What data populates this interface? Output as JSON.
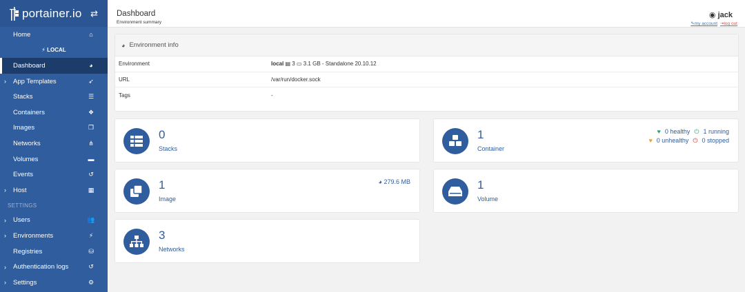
{
  "app": {
    "logo_text": "portainer.io"
  },
  "sidebar": {
    "items": [
      {
        "label": "Home",
        "icon": "home-icon"
      },
      {
        "label": "LOCAL",
        "icon": "plug-icon"
      },
      {
        "label": "Dashboard",
        "icon": "dashboard-icon"
      },
      {
        "label": "App Templates",
        "icon": "rocket-icon"
      },
      {
        "label": "Stacks",
        "icon": "list-icon"
      },
      {
        "label": "Containers",
        "icon": "cubes-icon"
      },
      {
        "label": "Images",
        "icon": "clone-icon"
      },
      {
        "label": "Networks",
        "icon": "sitemap-icon"
      },
      {
        "label": "Volumes",
        "icon": "hdd-icon"
      },
      {
        "label": "Events",
        "icon": "history-icon"
      },
      {
        "label": "Host",
        "icon": "th-icon"
      },
      {
        "label": "SETTINGS"
      },
      {
        "label": "Users",
        "icon": "users-icon"
      },
      {
        "label": "Environments",
        "icon": "plug-icon"
      },
      {
        "label": "Registries",
        "icon": "database-icon"
      },
      {
        "label": "Authentication logs",
        "icon": "history-icon"
      },
      {
        "label": "Settings",
        "icon": "cogs-icon"
      }
    ]
  },
  "header": {
    "title": "Dashboard",
    "subtitle": "Environment summary",
    "user": "jack",
    "my_account": "my account",
    "log_out": "log out"
  },
  "env_info": {
    "title": "Environment info",
    "rows": {
      "environment": {
        "key": "Environment",
        "name": "local",
        "cpu": "3",
        "mem": "3.1 GB",
        "type": "- Standalone 20.10.12"
      },
      "url": {
        "key": "URL",
        "value": "/var/run/docker.sock"
      },
      "tags": {
        "key": "Tags",
        "value": "-"
      }
    }
  },
  "widgets": {
    "stacks": {
      "count": "0",
      "label": "Stacks"
    },
    "containers": {
      "count": "1",
      "label": "Container",
      "healthy": "0 healthy",
      "unhealthy": "0 unhealthy",
      "running": "1 running",
      "stopped": "0 stopped"
    },
    "images": {
      "count": "1",
      "label": "Image",
      "size": "279.6 MB"
    },
    "volumes": {
      "count": "1",
      "label": "Volume"
    },
    "networks": {
      "count": "3",
      "label": "Networks"
    }
  },
  "colors": {
    "sidebar": "#2f5d9e",
    "accent": "#2f5d9e",
    "active": "#1c3c6b"
  }
}
